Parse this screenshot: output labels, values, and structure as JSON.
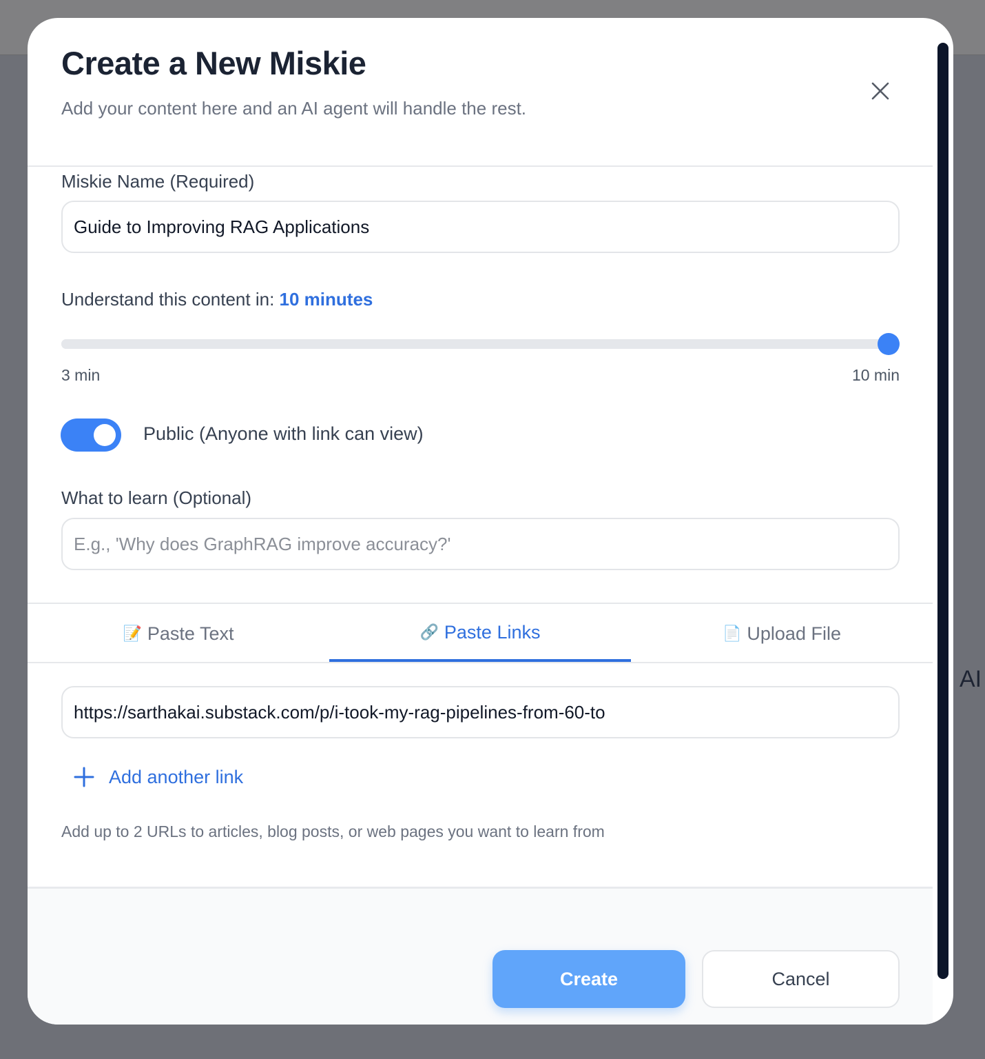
{
  "modal": {
    "title": "Create a New Miskie",
    "subtitle": "Add your content here and an AI agent will handle the rest."
  },
  "name_field": {
    "label": "Miskie Name (Required)",
    "value": "Guide to Improving RAG Applications"
  },
  "duration": {
    "label": "Understand this content in:",
    "value_label": "10 minutes",
    "min_label": "3 min",
    "max_label": "10 min",
    "min": 3,
    "max": 10,
    "value": 10
  },
  "visibility": {
    "label": "Public (Anyone with link can view)",
    "enabled": true
  },
  "learn_field": {
    "label": "What to learn (Optional)",
    "placeholder": "E.g., 'Why does GraphRAG improve accuracy?'"
  },
  "tabs": [
    {
      "icon": "📝",
      "label": "Paste Text",
      "active": false
    },
    {
      "icon": "🔗",
      "label": "Paste Links",
      "active": true
    },
    {
      "icon": "📄",
      "label": "Upload File",
      "active": false
    }
  ],
  "links": {
    "url_value": "https://sarthakai.substack.com/p/i-took-my-rag-pipelines-from-60-to",
    "add_label": "Add another link",
    "hint": "Add up to 2 URLs to articles, blog posts, or web pages you want to learn from"
  },
  "buttons": {
    "create": "Create",
    "cancel": "Cancel"
  },
  "background": {
    "text": "AI"
  },
  "colors": {
    "accent": "#2f6fde",
    "toggle_on": "#3b82f6",
    "create_button": "#60a5fa"
  }
}
